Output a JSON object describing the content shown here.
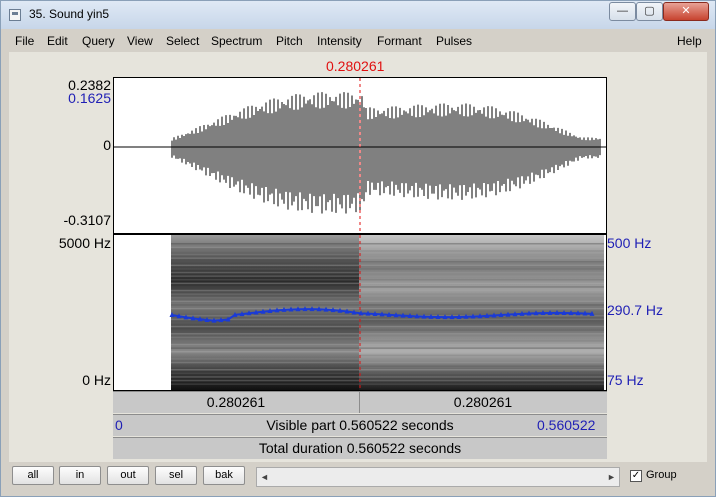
{
  "window": {
    "title": "35. Sound yin5",
    "min_glyph": "—",
    "max_glyph": "▢",
    "close_glyph": "✕"
  },
  "menu": [
    "File",
    "Edit",
    "Query",
    "View",
    "Select",
    "Spectrum",
    "Pitch",
    "Intensity",
    "Formant",
    "Pulses"
  ],
  "menu_help": "Help",
  "cursor": {
    "time": "0.280261"
  },
  "waveform": {
    "y_max": "0.2382",
    "y_blue": "0.1625",
    "y_zero": "0",
    "y_min": "-0.3107"
  },
  "spectrogram": {
    "freq_max": "5000 Hz",
    "freq_min": "0 Hz",
    "pitch_max": "500 Hz",
    "pitch_current": "290.7 Hz",
    "pitch_min": "75 Hz"
  },
  "time_bar": {
    "left_time": "0.280261",
    "right_time": "0.280261"
  },
  "visible_bar": {
    "start": "0",
    "text": "Visible part 0.560522 seconds",
    "end": "0.560522"
  },
  "total_bar": {
    "text": "Total duration 0.560522 seconds"
  },
  "buttons": {
    "all": "all",
    "in": "in",
    "out": "out",
    "sel": "sel",
    "bak": "bak"
  },
  "scroll": {
    "left_arrow": "◄",
    "right_arrow": "►"
  },
  "group": {
    "label": "Group",
    "checked": "✓"
  },
  "colors": {
    "pitch_curve": "#1a3ad6",
    "cursor": "#e01010",
    "axis_blue": "#1f1fb5"
  }
}
